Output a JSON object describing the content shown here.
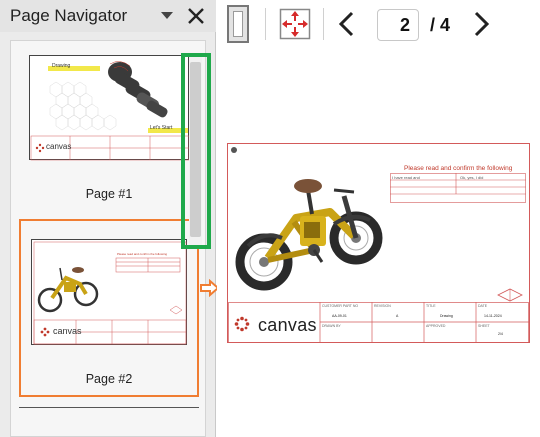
{
  "panel": {
    "title": "Page Navigator",
    "pages": [
      {
        "label": "Page #1",
        "tag_left": "Drawing",
        "tag_right": "Let's Start",
        "logo": "canvas"
      },
      {
        "label": "Page #2",
        "sheet_title": "Please read and confirm the following",
        "logo": "canvas"
      }
    ],
    "selected_page_color": "#f07d32",
    "scrollbar_highlight_color": "#1fa94b"
  },
  "toolbar": {
    "fit_page_icon": "fit-page-icon",
    "fit_window_icon": "fit-window-icon",
    "current_page": "2",
    "total_pages": "/ 4"
  },
  "drawing": {
    "sheet_title": "Please read and confirm the following",
    "sign_header_left": "I have read and",
    "sign_header_right": "Ok, yes, I did",
    "logo": "canvas",
    "title_block": {
      "field1_label": "CUSTOMER PART NO",
      "field1_value": "AA-09-01",
      "field2_label": "REVISION",
      "field2_value": "A",
      "field3_label": "TITLE",
      "field3_value": "Drawing",
      "field4_label": "DATE",
      "field4_value": "14-11-2024",
      "field5_label": "DRAWN BY",
      "field6_label": "APPROVED",
      "field7_label": "SHEET",
      "field7_value": "2/4"
    },
    "accent_color": "#d35a5a"
  }
}
